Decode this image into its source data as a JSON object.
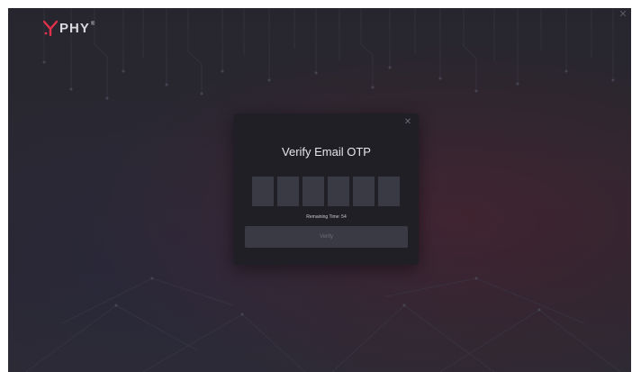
{
  "app": {
    "logo_text": "PHY",
    "logo_trademark": "®",
    "accent_color": "#e0304a",
    "window_close_icon": "close-icon"
  },
  "modal": {
    "title": "Verify Email OTP",
    "close_icon": "close-icon",
    "otp_inputs": [
      "",
      "",
      "",
      "",
      "",
      ""
    ],
    "timer_text": "Remaining Time: 54",
    "verify_label": "Verify",
    "verify_enabled": false
  }
}
